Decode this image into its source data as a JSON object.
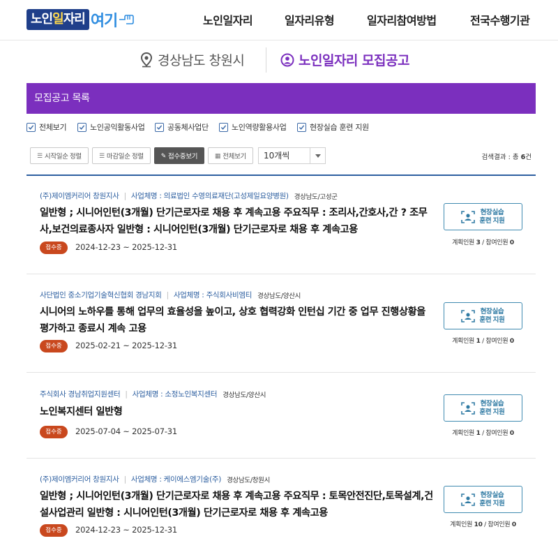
{
  "header": {
    "logo": {
      "part1": "노인",
      "part2": "일",
      "part3": "자리",
      "part4": "여기"
    },
    "nav": [
      "노인일자리",
      "일자리유형",
      "일자리참여방법",
      "전국수행기관"
    ]
  },
  "location": {
    "region": "경상남도 창원시",
    "section": "노인일자리 모집공고"
  },
  "banner": {
    "title": "모집공고 목록"
  },
  "filters": [
    {
      "label": "전체보기",
      "checked": true
    },
    {
      "label": "노인공익활동사업",
      "checked": true
    },
    {
      "label": "공동체사업단",
      "checked": true
    },
    {
      "label": "노인역량활용사업",
      "checked": true
    },
    {
      "label": "현장실습 훈련 지원",
      "checked": true
    }
  ],
  "toolbar": {
    "sort_start": "시작일순 정렬",
    "sort_end": "마감일순 정렬",
    "receiving": "접수중보기",
    "view_all": "전체보기",
    "page_size": "10개씩",
    "result_prefix": "검색결과 : 총",
    "result_count": "6",
    "result_suffix": "건"
  },
  "colors": {
    "accent": "#7b2fbe",
    "link": "#2d5fa0",
    "status": "#c9481e",
    "apply": "#2f7aa3"
  },
  "listings": [
    {
      "org": "(주)제이엠커리어 창원지사",
      "biz_label": "사업체명 : 의료법인 수영의료재단(고성제일요양병원)",
      "area": "경상남도/고성군",
      "title": "일반형 ; 시니어인턴(3개월) 단기근로자로 채용 후 계속고용 주요직무 : 조리사,간호사,간 ? 조무사,보건의료종사자 일반형 : 시니어인턴(3개월) 단기근로자로 채용 후 계속고용",
      "status": "접수중",
      "period": "2024-12-23 ~ 2025-12-31",
      "apply_line1": "현장실습",
      "apply_line2": "훈련 지원",
      "planned_label": "계획인원",
      "planned": "3",
      "joined_label": "참여인원",
      "joined": "0"
    },
    {
      "org": "사단법인 중소기업기술혁신협회 경남지회",
      "biz_label": "사업체명 : 주식회사비엠티",
      "area": "경상남도/양산시",
      "title": "시니어의 노하우를 통해 업무의 효율성을 높이고, 상호 협력강화 인턴십 기간 중 업무 진행상황을 평가하고 종료시 계속 고용",
      "status": "접수중",
      "period": "2025-02-21 ~ 2025-12-31",
      "apply_line1": "현장실습",
      "apply_line2": "훈련 지원",
      "planned_label": "계획인원",
      "planned": "1",
      "joined_label": "참여인원",
      "joined": "0"
    },
    {
      "org": "주식회사 경남취업지원센터",
      "biz_label": "사업체명 : 소정노인복지센터",
      "area": "경상남도/양산시",
      "title": "노인복지센터 일반형",
      "status": "접수중",
      "period": "2025-07-04 ~ 2025-07-31",
      "apply_line1": "현장실습",
      "apply_line2": "훈련 지원",
      "planned_label": "계획인원",
      "planned": "1",
      "joined_label": "참여인원",
      "joined": "0"
    },
    {
      "org": "(주)제이엠커리어 창원지사",
      "biz_label": "사업체명 : 케이에스엠기술(주)",
      "area": "경상남도/창원시",
      "title": "일반형 ; 시니어인턴(3개월) 단기근로자로 채용 후 계속고용 주요직무 : 토목안전진단,토목설계,건설사업관리 일반형 : 시니어인턴(3개월) 단기근로자로 채용 후 계속고용",
      "status": "접수중",
      "period": "2024-12-23 ~ 2025-12-31",
      "apply_line1": "현장실습",
      "apply_line2": "훈련 지원",
      "planned_label": "계획인원",
      "planned": "10",
      "joined_label": "참여인원",
      "joined": "0"
    }
  ]
}
